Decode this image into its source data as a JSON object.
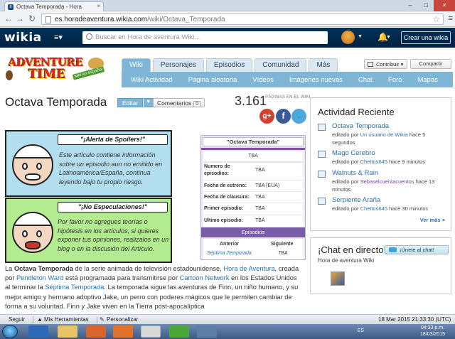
{
  "browser": {
    "tab_title": "Octava Temporada - Hora",
    "url_host": "es.horadeaventura.wikia.com",
    "url_path": "/wiki/Octava_Temporada"
  },
  "wikia_header": {
    "logo": "wikia",
    "search_placeholder": "Buscar en Hora de aventura Wiki...",
    "create_wiki": "Crear una wikia"
  },
  "community": {
    "logo_line1": "ADVENTURE",
    "logo_line2": "TIME",
    "logo_sub": "wiki en español",
    "tabs": [
      "Wiki",
      "Personajes",
      "Episodios",
      "Comunidad",
      "Más"
    ],
    "subnav": [
      "Wiki Actividad",
      "Página aleatoria",
      "Vídeos",
      "Imágenes nuevas",
      "Chat",
      "Foro",
      "Mapas"
    ],
    "contribuir": "Contribuir",
    "compartir": "Compartir"
  },
  "page": {
    "title": "Octava Temporada",
    "edit_label": "Editar",
    "comments_label": "Comentarios",
    "comments_count": "0",
    "page_count": "3.161",
    "page_count_label": "PÁGINAS EN EL WIKI"
  },
  "spoiler": {
    "title": "\"¡Alerta de Spoilers!\"",
    "text": "Este artículo contiene información sobre un episodio aun no emitido en Latinoamérica/España, continua leyendo bajo tu propio riesgo."
  },
  "speculation": {
    "title": "\"¡No Especulaciones!\"",
    "text": "Por favor no agregues teorías o hipótesis en los artículos, si quieres exponer tus opiniones, realizalos en un blog o en la discusión del Artículo."
  },
  "infobox": {
    "title": "\"Octava Temporada\"",
    "image_alt": "TBA",
    "rows": [
      {
        "k": "Numero de episodios:",
        "v": "TBA"
      },
      {
        "k": "Fecha de estreno:",
        "v": "TBA (EUA)"
      },
      {
        "k": "Fecha de clausura:",
        "v": "TBA"
      },
      {
        "k": "Primer episodio:",
        "v": "TBA"
      },
      {
        "k": "Ultimo episodio:",
        "v": "TBA"
      }
    ],
    "section": "Episodios",
    "prev_label": "Anterior",
    "next_label": "Siguiente",
    "prev_value": "Séptima Temporada",
    "next_value": "TBA"
  },
  "body": {
    "p1_a": "La ",
    "p1_bold": "Octava Temporada",
    "p1_b": " de la serie animada de televisión estadounidense, ",
    "link1": "Hora de Aventura",
    "p1_c": ", creada por ",
    "link2": "Pendleton Ward",
    "p1_d": " está programada para transmitirse por ",
    "link3": "Cartoon Network",
    "p1_e": " en los Estados Unidos al terminar la ",
    "link4": "Séptima Temporada",
    "p1_f": ". La temporada sigue las aventuras de Finn, un niño humano, y su mejor amigo y hermano adoptivo Jake, un perro con poderes mágicos que le permiten cambiar de forma a su voluntad. Finn y Jake viven en la Tierra post-apocalíptica"
  },
  "activity": {
    "title": "Actividad Reciente",
    "items": [
      {
        "name": "Octava Temporada",
        "pre": "editado por ",
        "user": "Un usuario de Wikia",
        "post": " hace 5 segundos"
      },
      {
        "name": "Mago Cerebro",
        "pre": "editado por ",
        "user": "Chettos645",
        "post": " hace 9 minutos"
      },
      {
        "name": "Walnuts & Rain",
        "pre": "editado por ",
        "user": "Sebaselcuentacuentos",
        "post": " hace 13 minutos"
      },
      {
        "name": "Serpiente Araña",
        "pre": "editado por ",
        "user": "Chettos645",
        "post": " hace 30 minutos"
      }
    ],
    "more": "Ver más >"
  },
  "chat": {
    "title": "¡Chat en directo!",
    "button": "¡Únete al chat!",
    "sub": "Hora de aventura Wiki"
  },
  "toolbar": {
    "seguir": "Seguir",
    "herramientas": "Mis Herramientas",
    "personalizar": "Personalizar",
    "timestamp": "18 Mar 2015 21:33:30 (UTC)"
  },
  "taskbar": {
    "lang": "ES",
    "time": "04:33 p.m.",
    "date": "18/03/2015"
  }
}
